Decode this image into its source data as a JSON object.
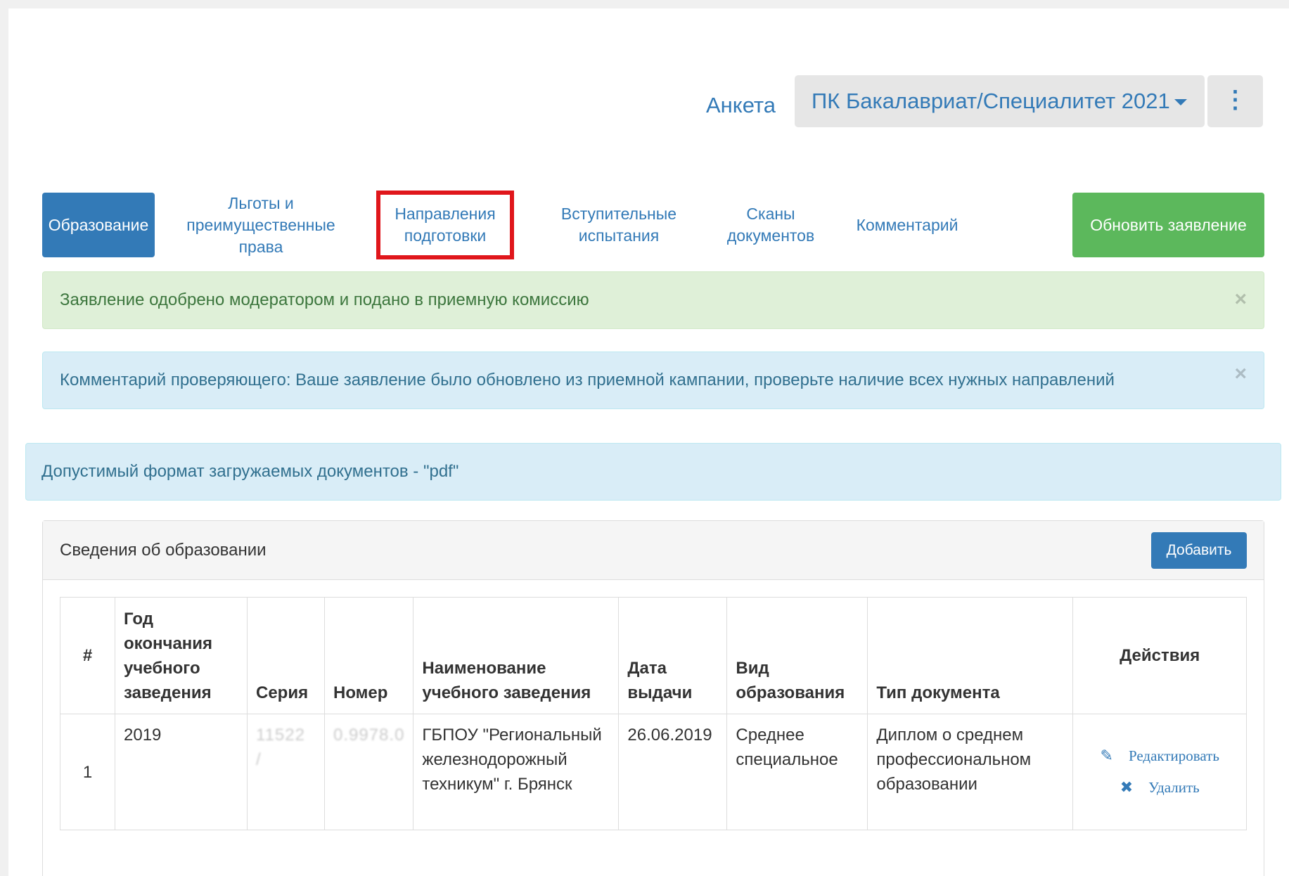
{
  "header": {
    "anketa_label": "Анкета",
    "campaign_label": "ПК Бакалавриат/Специалитет 2021",
    "menu_icon": "vertical-ellipsis-icon",
    "menu_glyph": "⋮"
  },
  "tabs": [
    {
      "label": "Образование",
      "state": "active"
    },
    {
      "label": "Льготы и преимущественные права",
      "state": "normal"
    },
    {
      "label": "Направления подготовки",
      "state": "highlighted"
    },
    {
      "label": "Вступительные испытания",
      "state": "normal"
    },
    {
      "label": "Сканы документов",
      "state": "normal"
    },
    {
      "label": "Комментарий",
      "state": "normal"
    }
  ],
  "update_button": "Обновить заявление",
  "alerts": {
    "approved": "Заявление одобрено модератором и подано в приемную комиссию",
    "reviewer_comment": "Комментарий проверяющего: Ваше заявление было обновлено из приемной кампании, проверьте наличие всех нужных направлений",
    "format": "Допустимый формат загружаемых документов - \"pdf\"",
    "close_glyph": "×"
  },
  "panel": {
    "title": "Сведения об образовании",
    "add_button": "Добавить"
  },
  "table": {
    "headers": {
      "num": "#",
      "year": "Год окончания учебного заведения",
      "series": "Серия",
      "number": "Номер",
      "institution": "Наименование учебного заведения",
      "date": "Дата выдачи",
      "edu_type": "Вид образования",
      "doc_type": "Тип документа",
      "actions": "Действия"
    },
    "rows": [
      {
        "num": "1",
        "year": "2019",
        "series": "11522 /",
        "number": "0.9978.0",
        "institution": "ГБПОУ \"Региональный железнодорожный техникум\" г. Брянск",
        "date": "26.06.2019",
        "edu_type": "Среднее специальное",
        "doc_type": "Диплом о среднем профессиональном образовании",
        "edit_label": "Редактировать",
        "delete_label": "Удалить"
      }
    ]
  },
  "colors": {
    "primary": "#337ab7",
    "success": "#5cb85c",
    "highlight": "#e0161b"
  }
}
